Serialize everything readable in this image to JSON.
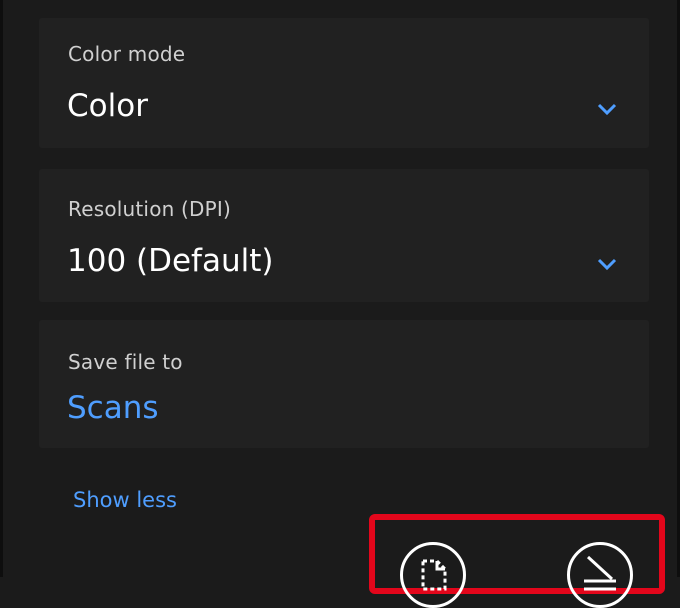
{
  "color_mode": {
    "label": "Color mode",
    "value": "Color"
  },
  "resolution": {
    "label": "Resolution (DPI)",
    "value": "100 (Default)"
  },
  "save_location": {
    "label": "Save file to",
    "value": "Scans"
  },
  "show_less_link": "Show less",
  "action_buttons": {
    "preview_icon": "preview-crop-icon",
    "scan_icon": "scan-icon"
  },
  "colors": {
    "background": "#1b1b1b",
    "card": "#212121",
    "accent": "#4f9eff",
    "highlight": "#e3061b"
  }
}
